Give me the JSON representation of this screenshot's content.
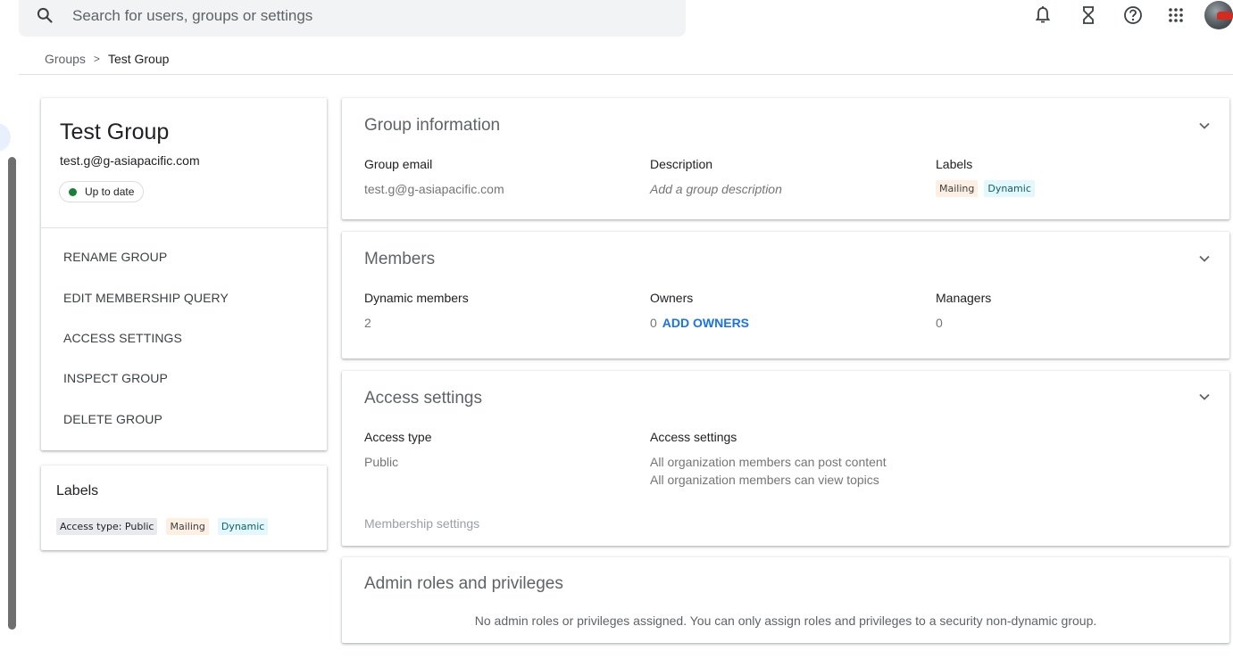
{
  "search": {
    "placeholder": "Search for users, groups or settings"
  },
  "top_icons": [
    "search-icon",
    "bell-icon",
    "hourglass-icon",
    "help-icon",
    "apps-grid-icon",
    "avatar"
  ],
  "breadcrumb": {
    "parent": "Groups",
    "separator": ">",
    "current": "Test Group"
  },
  "group": {
    "name": "Test Group",
    "email": "test.g@g-asiapacific.com",
    "status": "Up to date",
    "actions": [
      "RENAME GROUP",
      "EDIT MEMBERSHIP QUERY",
      "ACCESS SETTINGS",
      "INSPECT GROUP",
      "DELETE GROUP"
    ]
  },
  "labels_card": {
    "title": "Labels",
    "chips": [
      "Access type: Public",
      "Mailing",
      "Dynamic"
    ]
  },
  "group_info": {
    "title": "Group information",
    "email_label": "Group email",
    "email_value": "test.g@g-asiapacific.com",
    "description_label": "Description",
    "description_value": "Add a group description",
    "labels_label": "Labels",
    "labels": [
      "Mailing",
      "Dynamic"
    ]
  },
  "members": {
    "title": "Members",
    "dynamic_label": "Dynamic members",
    "dynamic_value": "2",
    "owners_label": "Owners",
    "owners_value": "0",
    "add_owners": "ADD OWNERS",
    "managers_label": "Managers",
    "managers_value": "0"
  },
  "access": {
    "title": "Access settings",
    "type_label": "Access type",
    "type_value": "Public",
    "settings_label": "Access settings",
    "settings_line1": "All organization members can post content",
    "settings_line2": "All organization members can view topics",
    "membership_settings": "Membership settings"
  },
  "admin": {
    "title": "Admin roles and privileges",
    "notice": "No admin roles or privileges assigned. You can only assign roles and privileges to a security non-dynamic group."
  },
  "colors": {
    "status_dot": "#188038",
    "link": "#1a73e8",
    "label_mailing_bg": "#feefe3",
    "label_dynamic_bg": "#e4f7fb"
  }
}
